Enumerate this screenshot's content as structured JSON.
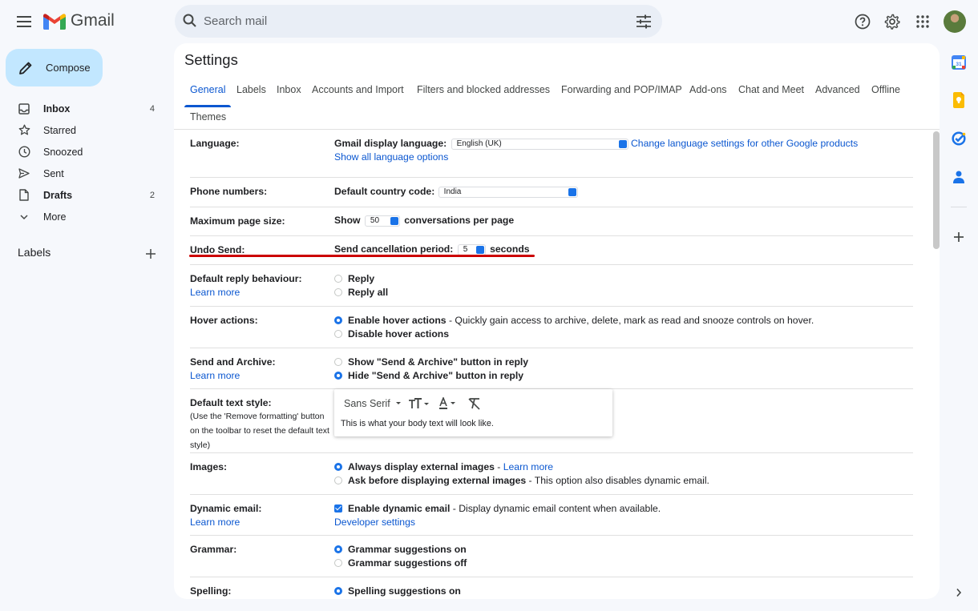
{
  "app": {
    "name": "Gmail"
  },
  "search": {
    "placeholder": "Search mail"
  },
  "compose": {
    "label": "Compose"
  },
  "nav": {
    "items": [
      {
        "label": "Inbox",
        "count": "4"
      },
      {
        "label": "Starred",
        "count": ""
      },
      {
        "label": "Snoozed",
        "count": ""
      },
      {
        "label": "Sent",
        "count": ""
      },
      {
        "label": "Drafts",
        "count": "2"
      },
      {
        "label": "More",
        "count": ""
      }
    ],
    "labels_header": "Labels"
  },
  "settings": {
    "title": "Settings",
    "tabs": [
      "General",
      "Labels",
      "Inbox",
      "Accounts and Import",
      "Filters and blocked addresses",
      "Forwarding and POP/IMAP",
      "Add-ons",
      "Chat and Meet",
      "Advanced",
      "Offline",
      "Themes"
    ],
    "active_tab": "General",
    "language": {
      "label": "Language:",
      "display_label": "Gmail display language:",
      "value": "English (UK)",
      "change_link": "Change language settings for other Google products",
      "show_all_link": "Show all language options"
    },
    "phone": {
      "label": "Phone numbers:",
      "country_label": "Default country code:",
      "value": "India"
    },
    "page_size": {
      "label": "Maximum page size:",
      "show": "Show",
      "value": "50",
      "suffix": "conversations per page"
    },
    "undo_send": {
      "label": "Undo Send:",
      "period_label": "Send cancellation period:",
      "value": "5",
      "suffix": "seconds"
    },
    "reply": {
      "label": "Default reply behaviour:",
      "learn_more": "Learn more",
      "opt1": "Reply",
      "opt2": "Reply all"
    },
    "hover": {
      "label": "Hover actions:",
      "opt1": "Enable hover actions",
      "opt1_desc": " - Quickly gain access to archive, delete, mark as read and snooze controls on hover.",
      "opt2": "Disable hover actions"
    },
    "send_archive": {
      "label": "Send and Archive:",
      "learn_more": "Learn more",
      "opt1": "Show \"Send & Archive\" button in reply",
      "opt2": "Hide \"Send & Archive\" button in reply"
    },
    "text_style": {
      "label": "Default text style:",
      "note": "(Use the 'Remove formatting' button on the toolbar to reset the default text style)",
      "font": "Sans Serif",
      "preview": "This is what your body text will look like."
    },
    "images": {
      "label": "Images:",
      "opt1": "Always display external images",
      "opt1_sep": " - ",
      "opt1_link": "Learn more",
      "opt2": "Ask before displaying external images",
      "opt2_desc": " - This option also disables dynamic email."
    },
    "dynamic": {
      "label": "Dynamic email:",
      "learn_more": "Learn more",
      "opt": "Enable dynamic email",
      "opt_desc": " - Display dynamic email content when available.",
      "dev_link": "Developer settings"
    },
    "grammar": {
      "label": "Grammar:",
      "opt1": "Grammar suggestions on",
      "opt2": "Grammar suggestions off"
    },
    "spelling": {
      "label": "Spelling:",
      "opt1": "Spelling suggestions on"
    }
  },
  "colors": {
    "accent": "#0b57d0",
    "compose_bg": "#c2e7ff",
    "highlight": "#cc0000"
  },
  "icons": [
    "menu-icon",
    "gmail-logo-icon",
    "search-icon",
    "tune-icon",
    "help-icon",
    "gear-icon",
    "apps-icon",
    "pencil-icon",
    "inbox-icon",
    "star-icon",
    "clock-icon",
    "send-icon",
    "draft-icon",
    "chevron-down-icon",
    "plus-icon",
    "calendar-icon",
    "keep-icon",
    "tasks-icon",
    "contacts-icon",
    "chevron-right-icon"
  ]
}
